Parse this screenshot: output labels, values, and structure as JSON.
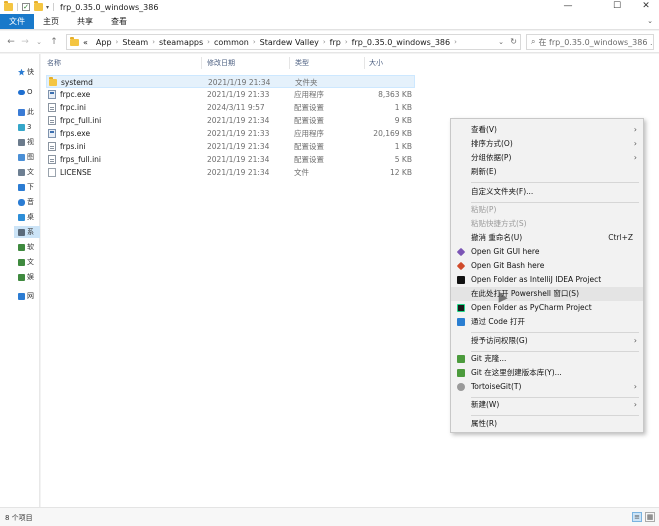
{
  "window": {
    "title": "frp_0.35.0_windows_386",
    "minimize": "—",
    "maximize": "☐",
    "close": "✕"
  },
  "ribbon": {
    "tabs": [
      "文件",
      "主页",
      "共享",
      "查看"
    ]
  },
  "address": {
    "chevron": "«",
    "crumbs": [
      "App",
      "Steam",
      "steamapps",
      "common",
      "Stardew Valley",
      "frp",
      "frp_0.35.0_windows_386"
    ],
    "search_placeholder": "在 frp_0.35.0_windows_386 ..."
  },
  "nav_pane": {
    "items": [
      {
        "label": "快",
        "icon": "star-icon",
        "color": "#2b7cd3"
      },
      {
        "label": "O",
        "icon": "onedrive-icon",
        "color": "#1f6fd0"
      },
      {
        "label": "此",
        "icon": "computer-icon",
        "color": "#3a7bd5"
      },
      {
        "label": "3",
        "icon": "3d-icon",
        "color": "#35a6c9"
      },
      {
        "label": "视",
        "icon": "video-icon",
        "color": "#6b7b8c"
      },
      {
        "label": "图",
        "icon": "picture-icon",
        "color": "#4a8fd6"
      },
      {
        "label": "文",
        "icon": "document-icon",
        "color": "#6d7f92"
      },
      {
        "label": "下",
        "icon": "download-icon",
        "color": "#2b7cd3"
      },
      {
        "label": "音",
        "icon": "music-icon",
        "color": "#2b7cd3"
      },
      {
        "label": "桌",
        "icon": "desktop-icon",
        "color": "#2d8ed8"
      },
      {
        "label": "系",
        "icon": "drive-icon",
        "color": "#5a6a7a"
      },
      {
        "label": "软",
        "icon": "drive-icon",
        "color": "#3f8a3f"
      },
      {
        "label": "文",
        "icon": "drive-icon",
        "color": "#3f8a3f"
      },
      {
        "label": "娱",
        "icon": "drive-icon",
        "color": "#3f8a3f"
      },
      {
        "label": "网",
        "icon": "network-icon",
        "color": "#2b7cd3"
      }
    ]
  },
  "columns": {
    "name": "名称",
    "date": "修改日期",
    "type": "类型",
    "size": "大小"
  },
  "files": [
    {
      "name": "systemd",
      "date": "2021/1/19 21:34",
      "type": "文件夹",
      "size": "",
      "icon": "folder-icon"
    },
    {
      "name": "frpc.exe",
      "date": "2021/1/19 21:33",
      "type": "应用程序",
      "size": "8,363 KB",
      "icon": "exe-icon"
    },
    {
      "name": "frpc.ini",
      "date": "2024/3/11 9:57",
      "type": "配置设置",
      "size": "1 KB",
      "icon": "ini-icon"
    },
    {
      "name": "frpc_full.ini",
      "date": "2021/1/19 21:34",
      "type": "配置设置",
      "size": "9 KB",
      "icon": "ini-icon"
    },
    {
      "name": "frps.exe",
      "date": "2021/1/19 21:33",
      "type": "应用程序",
      "size": "20,169 KB",
      "icon": "exe-icon"
    },
    {
      "name": "frps.ini",
      "date": "2021/1/19 21:34",
      "type": "配置设置",
      "size": "1 KB",
      "icon": "ini-icon"
    },
    {
      "name": "frps_full.ini",
      "date": "2021/1/19 21:34",
      "type": "配置设置",
      "size": "5 KB",
      "icon": "ini-icon"
    },
    {
      "name": "LICENSE",
      "date": "2021/1/19 21:34",
      "type": "文件",
      "size": "12 KB",
      "icon": "file-icon"
    }
  ],
  "status": {
    "count": "8 个项目"
  },
  "context_menu": {
    "items": [
      {
        "label": "查看(V)",
        "submenu": true
      },
      {
        "label": "排序方式(O)",
        "submenu": true
      },
      {
        "label": "分组依据(P)",
        "submenu": true
      },
      {
        "label": "刷新(E)"
      },
      {
        "sep": true
      },
      {
        "label": "自定义文件夹(F)..."
      },
      {
        "sep": true
      },
      {
        "label": "粘贴(P)",
        "disabled": true
      },
      {
        "label": "粘贴快捷方式(S)",
        "disabled": true
      },
      {
        "label": "撤消 重命名(U)",
        "shortcut": "Ctrl+Z"
      },
      {
        "label": "Open Git GUI here",
        "icon": "git-gui-icon",
        "color": "#7b55b5"
      },
      {
        "label": "Open Git Bash here",
        "icon": "git-bash-icon",
        "color": "#d04a2a"
      },
      {
        "label": "Open Folder as IntelliJ IDEA Project",
        "icon": "intellij-icon",
        "color": "#111111"
      },
      {
        "label": "在此处打开 Powershell 窗口(S)",
        "hover": true
      },
      {
        "label": "Open Folder as PyCharm Project",
        "icon": "pycharm-icon",
        "color": "#1b1b1b"
      },
      {
        "label": "通过 Code 打开",
        "icon": "vscode-icon",
        "color": "#2a7ed1"
      },
      {
        "sep": true
      },
      {
        "label": "授予访问权限(G)",
        "submenu": true
      },
      {
        "sep": true
      },
      {
        "label": "Git 克隆...",
        "icon": "tortoisegit-icon",
        "color": "#4c9b3d"
      },
      {
        "label": "Git 在这里创建版本库(Y)...",
        "icon": "tortoisegit-icon",
        "color": "#4c9b3d"
      },
      {
        "label": "TortoiseGit(T)",
        "icon": "tortoisegit-icon",
        "color": "#4c9b3d",
        "submenu": true
      },
      {
        "sep": true
      },
      {
        "label": "新建(W)",
        "submenu": true
      },
      {
        "sep": true
      },
      {
        "label": "属性(R)"
      }
    ]
  },
  "colors": {
    "accent": "#1979ca",
    "selection": "#cce4f7"
  }
}
